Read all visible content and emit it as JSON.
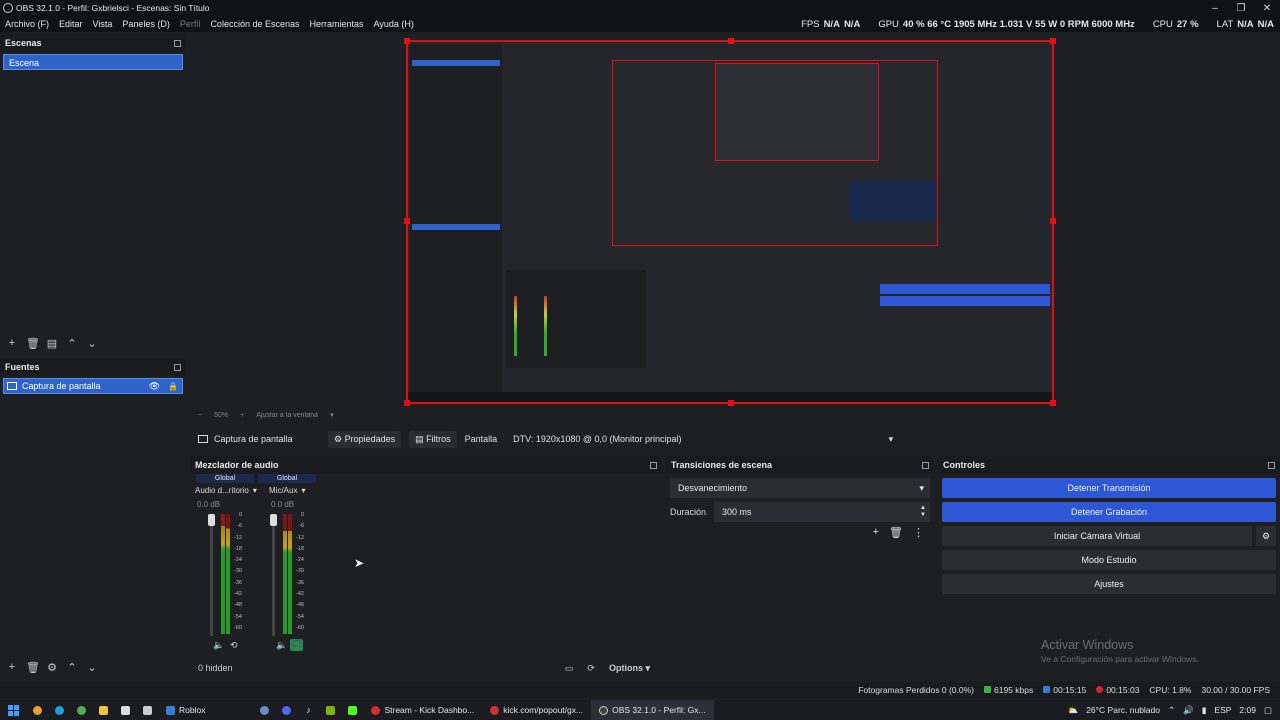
{
  "window": {
    "title": "OBS 32.1.0 - Perfil: Gxbrielsci - Escenas: Sin Título"
  },
  "menu": [
    "Archivo (F)",
    "Editar",
    "Vista",
    "Paneles (D)",
    "Perfil",
    "Colección de Escenas",
    "Herramientas",
    "Ayuda (H)"
  ],
  "stats": {
    "fps_label": "FPS",
    "fps_values": [
      "N/A",
      "N/A"
    ],
    "gpu_label": "GPU",
    "gpu_value": "40 % 66 °C 1905 MHz 1.031 V 55 W 0 RPM 6000 MHz",
    "cpu_label": "CPU",
    "cpu_value": "27 %",
    "lat_label": "LAT",
    "lat_values": [
      "N/A",
      "N/A"
    ]
  },
  "scenes": {
    "title": "Escenas",
    "items": [
      "Escena"
    ]
  },
  "sources": {
    "title": "Fuentes",
    "items": [
      "Captura de pantalla"
    ]
  },
  "preview": {
    "zoom": "50%",
    "fit": "Ajustar a la ventana"
  },
  "source_toolbar": {
    "source_name": "Captura de pantalla",
    "properties": "Propiedades",
    "filters": "Filtros",
    "screen_label": "Pantalla",
    "screen_value": "DTV: 1920x1080 @ 0,0 (Monitor principal)"
  },
  "mixer": {
    "title": "Mezclador de audio",
    "channels": [
      {
        "head": "Global",
        "name": "Audio d...ritorio",
        "db": "0.0 dB"
      },
      {
        "head": "Global",
        "name": "Mic/Aux",
        "db": "0.0 dB"
      }
    ],
    "scale": [
      "0",
      "-6",
      "-12",
      "-18",
      "-24",
      "-30",
      "-36",
      "-42",
      "-48",
      "-54",
      "-60"
    ],
    "hidden": "0 hidden",
    "options": "Options"
  },
  "transitions": {
    "title": "Transiciones de escena",
    "type": "Desvanecimiento",
    "duration_label": "Duración",
    "duration_value": "300 ms"
  },
  "controls": {
    "title": "Controles",
    "buttons": [
      "Detener Transmisión",
      "Detener Grabación",
      "Iniciar Cámara Virtual",
      "Modo Estudio",
      "Ajustes"
    ]
  },
  "watermark": {
    "line1": "Activar Windows",
    "line2": "Ve a Configuración para activar Windows."
  },
  "statusbar": {
    "dropped": "Fotogramas Perdidos 0 (0.0%)",
    "bitrate": "6195 kbps",
    "stream_time": "00:15:15",
    "rec_time": "00:15:03",
    "cpu": "CPU: 1.8%",
    "fps": "30.00 / 30.00 FPS",
    "colors": {
      "bitrate": "#3cb43c",
      "stream": "#3a7bd5",
      "rec": "#e02020"
    }
  },
  "taskbar": {
    "apps": [
      "Roblox",
      "Stream - Kick Dashbo...",
      "kick.com/popout/gx...",
      "OBS 32.1.0 - Perfil: Gx..."
    ],
    "weather": "26°C Parc. nublado",
    "lang": "ESP",
    "time": "2:09"
  }
}
